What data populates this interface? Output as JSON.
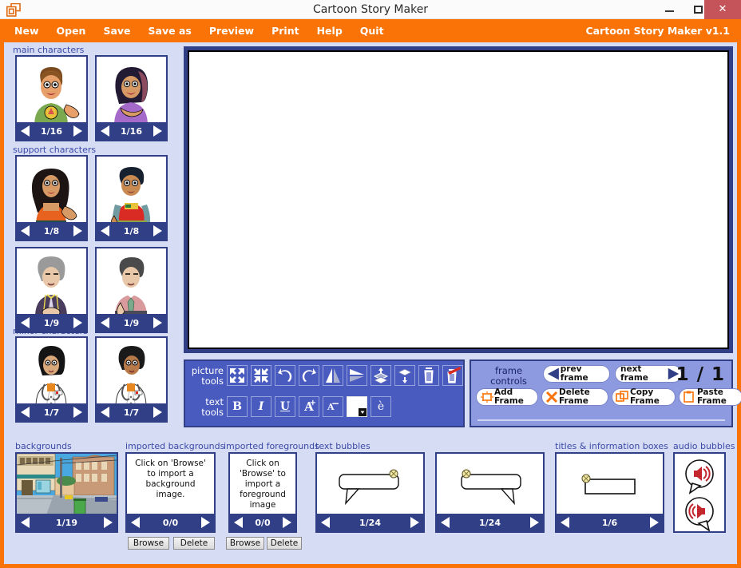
{
  "window": {
    "title": "Cartoon Story Maker",
    "app_icon": "overlapping-squares-icon",
    "minimize": "−",
    "maximize": "□",
    "close": "✕"
  },
  "menubar": {
    "items": [
      "New",
      "Open",
      "Save",
      "Save as",
      "Preview",
      "Print",
      "Help",
      "Quit"
    ],
    "brand": "Cartoon Story Maker v1.1",
    "bg_color": "#f97306"
  },
  "character_panels": [
    {
      "label": "main characters",
      "cards": [
        {
          "count": "1/16"
        },
        {
          "count": "1/16"
        }
      ]
    },
    {
      "label": "support characters",
      "cards": [
        {
          "count": "1/8"
        },
        {
          "count": "1/8"
        }
      ]
    },
    {
      "label": "",
      "cards": [
        {
          "count": "1/9"
        },
        {
          "count": "1/9"
        }
      ]
    },
    {
      "label": "minor characters",
      "cards": [
        {
          "count": "1/7"
        },
        {
          "count": "1/7"
        }
      ]
    }
  ],
  "tools": {
    "picture_label": "picture\ntools",
    "text_label": "text\ntools",
    "picture_buttons": [
      "expand-icon",
      "shrink-icon",
      "undo-icon",
      "redo-icon",
      "flip-horizontal-icon",
      "flip-vertical-icon",
      "bring-to-front-icon",
      "send-to-back-icon",
      "delete-icon",
      "delete-all-icon"
    ],
    "text_buttons": [
      {
        "name": "bold-button",
        "label": "B"
      },
      {
        "name": "italic-button",
        "label": "I"
      },
      {
        "name": "underline-button",
        "label": "U"
      },
      {
        "name": "increase-font-button",
        "label": "A"
      },
      {
        "name": "decrease-font-button",
        "label": "A"
      },
      {
        "name": "text-color-button",
        "label": ""
      },
      {
        "name": "accent-character-button",
        "label": "è"
      }
    ]
  },
  "frame_controls": {
    "label": "frame\ncontrols",
    "prev_frame": "prev frame",
    "next_frame": "next frame",
    "counter": "1 / 1",
    "add_frame": "Add\nFrame",
    "delete_frame": "Delete\nFrame",
    "copy_frame": "Copy\nFrame",
    "paste_frame": "Paste\nFrame"
  },
  "bottom": {
    "backgrounds": {
      "label": "backgrounds",
      "count": "1/19"
    },
    "imported_backgrounds": {
      "label": "imported backgrounds",
      "message": "Click on 'Browse' to import a background image.",
      "count": "0/0",
      "browse": "Browse",
      "delete": "Delete"
    },
    "imported_foregrounds": {
      "label": "imported foregrounds",
      "message": "Click on 'Browse' to import a foreground image",
      "count": "0/0",
      "browse": "Browse",
      "delete": "Delete"
    },
    "text_bubbles": {
      "label": "text bubbles",
      "left_count": "1/24",
      "right_count": "1/24"
    },
    "titles_boxes": {
      "label": "titles & information boxes",
      "count": "1/6"
    },
    "audio_bubbles": {
      "label": "audio bubbles",
      "icons": [
        "speaker-loud-icon",
        "speaker-quiet-icon"
      ]
    }
  },
  "colors": {
    "orange": "#f97306",
    "navy": "#313f86",
    "panel_blue": "#4a5bc0",
    "light_lavender": "#d7dcf5",
    "frame_panel": "#8d9ae0",
    "label_blue": "#3a4aa8"
  }
}
